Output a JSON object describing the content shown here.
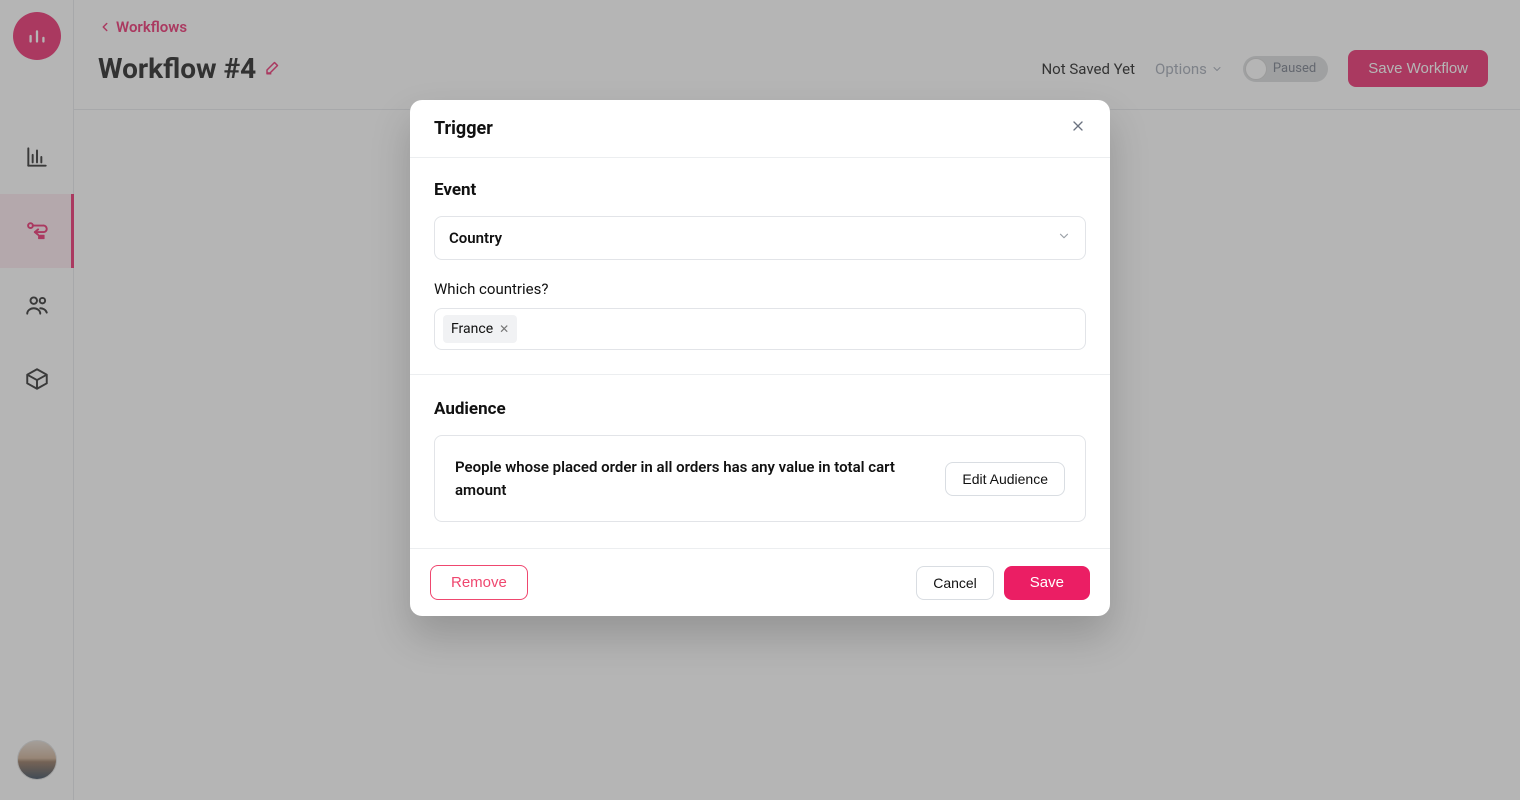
{
  "sidebar": {
    "icons": [
      "chart-icon",
      "workflow-icon",
      "users-icon",
      "box-icon"
    ]
  },
  "header": {
    "breadcrumb": "Workflows",
    "title": "Workflow #4",
    "status": "Not Saved Yet",
    "options": "Options",
    "toggle_label": "Paused",
    "save_label": "Save Workflow"
  },
  "modal": {
    "title": "Trigger",
    "event_label": "Event",
    "event_value": "Country",
    "countries_label": "Which countries?",
    "countries": [
      "France"
    ],
    "audience_label": "Audience",
    "audience_desc": "People whose placed order in all orders has any value in total cart amount",
    "edit_audience": "Edit Audience",
    "remove": "Remove",
    "cancel": "Cancel",
    "save": "Save"
  }
}
